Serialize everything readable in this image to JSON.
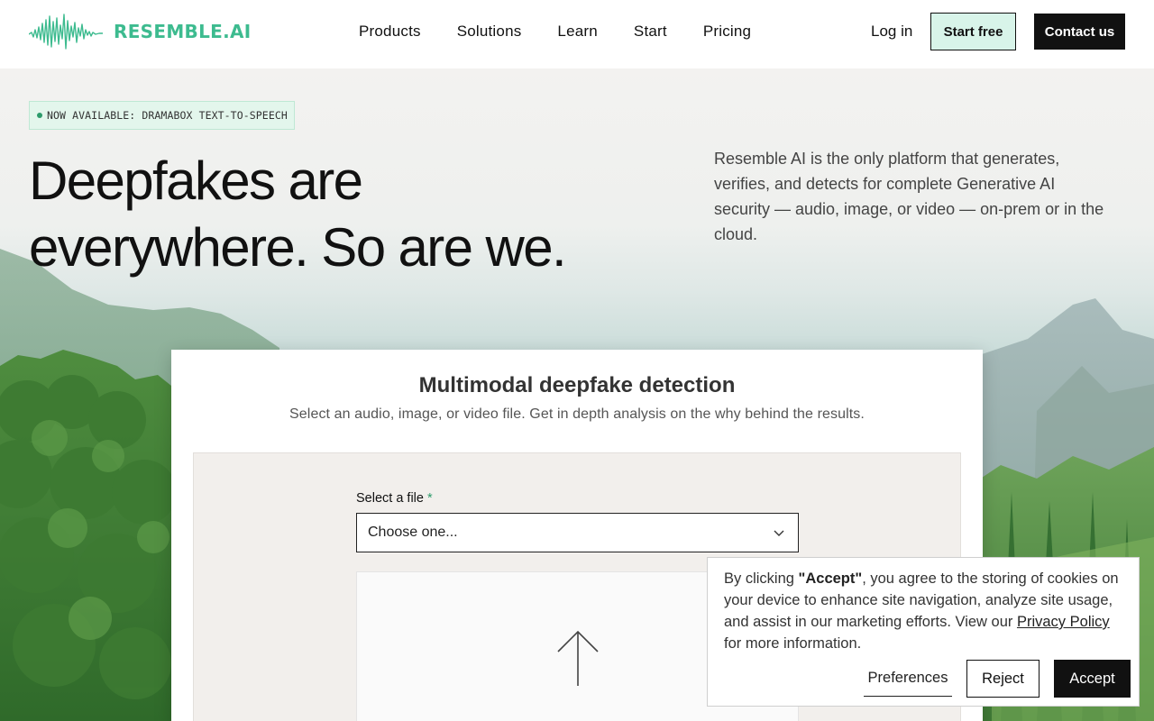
{
  "header": {
    "brand": "RESEMBLE.AI",
    "nav": [
      "Products",
      "Solutions",
      "Learn",
      "Start",
      "Pricing"
    ],
    "login_label": "Log in",
    "start_label": "Start free",
    "contact_label": "Contact us"
  },
  "hero": {
    "badge": "NOW AVAILABLE: DRAMABOX TEXT-TO-SPEECH",
    "headline_line1": "Deepfakes are",
    "headline_line2": "everywhere. So are we.",
    "description": "Resemble AI is the only platform that generates, verifies, and detects for complete Generative AI security — audio, image, or video — on-prem or in the cloud."
  },
  "detector": {
    "title": "Multimodal deepfake detection",
    "subtitle": "Select an audio, image, or video file. Get in depth analysis on the why behind the results.",
    "field_label": "Select a file",
    "required_mark": "*",
    "select_value": "Choose one...",
    "upload_icon": "arrow-up-icon"
  },
  "cookie": {
    "text_before": "By clicking ",
    "accept_quote": "\"Accept\"",
    "text_after": ", you agree to the storing of cookies on your device to enhance site navigation, analyze site usage, and assist in our marketing efforts. View our ",
    "privacy_link": "Privacy Policy",
    "text_end": " for more information.",
    "preferences_label": "Preferences",
    "reject_label": "Reject",
    "accept_label": "Accept"
  },
  "colors": {
    "brand_green": "#3dbb8f",
    "start_button_bg": "#d8f4e9",
    "dark": "#111111"
  }
}
